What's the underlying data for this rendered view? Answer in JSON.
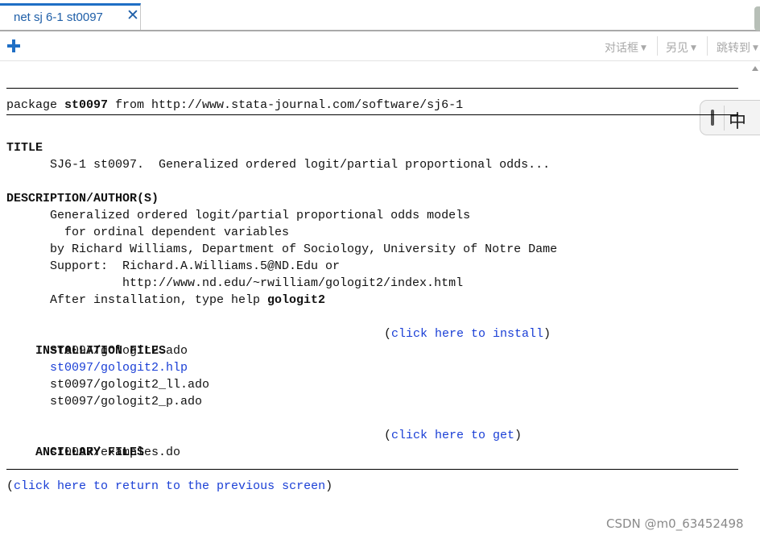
{
  "tab": {
    "label": "net sj 6-1 st0097",
    "close_glyph": "✕"
  },
  "toolbar": {
    "add_icon": "plus-icon",
    "menus": [
      {
        "label": "对话框"
      },
      {
        "label": "另见"
      },
      {
        "label": "跳转到"
      }
    ]
  },
  "ime": {
    "label": "中"
  },
  "content": {
    "header": {
      "prefix": "package ",
      "name": "st0097",
      "mid": " from ",
      "url": "http://www.stata-journal.com/software/sj6-1"
    },
    "title": {
      "heading": "TITLE",
      "text": "SJ6-1 st0097.  Generalized ordered logit/partial proportional odds..."
    },
    "description": {
      "heading": "DESCRIPTION/AUTHOR(S)",
      "line1": "Generalized ordered logit/partial proportional odds models",
      "line2": "for ordinal dependent variables",
      "line3": "by Richard Williams, Department of Sociology, University of Notre Dame",
      "line4": "Support:  Richard.A.Williams.5@ND.Edu or",
      "line5": "http://www.nd.edu/~rwilliam/gologit2/index.html",
      "line6_prefix": "After installation, type help ",
      "line6_cmd": "gologit2"
    },
    "installation": {
      "heading": "INSTALLATION FILES",
      "action_open": "(",
      "action_label": "click here to install",
      "action_close": ")",
      "files": [
        "st0097/gologit2.ado",
        "st0097/gologit2.hlp",
        "st0097/gologit2_ll.ado",
        "st0097/gologit2_p.ado"
      ]
    },
    "ancillary": {
      "heading": "ANCILLARY FILES",
      "action_open": "(",
      "action_label": "click here to get",
      "action_close": ")",
      "files": [
        "st0097/examples.do"
      ]
    },
    "footer": {
      "open": "(",
      "label": "click here to return to the previous screen",
      "close": ")"
    }
  },
  "watermark": "CSDN @m0_63452498",
  "colors": {
    "accent": "#1f6fc5",
    "link": "#1a3fd6",
    "text": "#111111"
  }
}
